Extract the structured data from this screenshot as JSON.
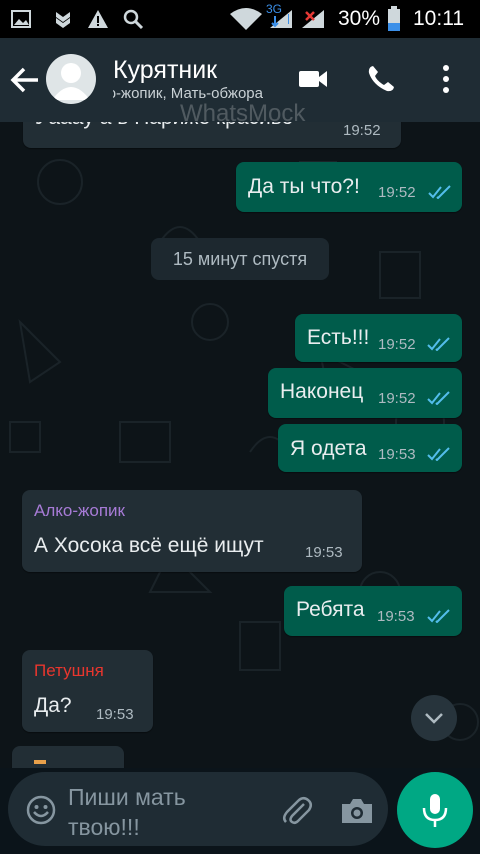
{
  "status_bar": {
    "network_label": "3G",
    "battery": "30%",
    "time": "10:11",
    "icons": [
      "image-icon",
      "shield-icon",
      "warning-icon",
      "search-icon",
      "wifi-icon",
      "signal-icon",
      "battery-icon"
    ]
  },
  "header": {
    "title": "Курятник",
    "subtitle": "Алко-жопик, Мать-обжора",
    "watermark": "WhatsMock"
  },
  "messages": [
    {
      "type": "in",
      "text": "Уаааy а в Париже красиво",
      "time": "19:52"
    },
    {
      "type": "out",
      "text": "Да ты что?!",
      "time": "19:52",
      "status": "read"
    },
    {
      "type": "date",
      "text": "15 минут спустя"
    },
    {
      "type": "out",
      "text": "Есть!!!",
      "time": "19:52",
      "status": "read"
    },
    {
      "type": "out",
      "text": "Наконец",
      "time": "19:52",
      "status": "read"
    },
    {
      "type": "out",
      "text": "Я одета",
      "time": "19:53",
      "status": "read"
    },
    {
      "type": "in",
      "sender": "Алко-жопик",
      "text": "А Хосока всё ещё ищут",
      "time": "19:53"
    },
    {
      "type": "out",
      "text": "Ребята",
      "time": "19:53",
      "status": "read"
    },
    {
      "type": "in",
      "sender": "Петушня",
      "text": "Да?",
      "time": "19:53"
    }
  ],
  "colors": {
    "out_bubble": "#005c4b",
    "in_bubble": "#222e35",
    "header": "#1f2c34",
    "read_tick": "#53bdeb",
    "sender_alko": "#a77bd6",
    "sender_petushnya": "#e8362e",
    "accent": "#00a884"
  },
  "input": {
    "placeholder": "Пиши мать твою!!!"
  }
}
